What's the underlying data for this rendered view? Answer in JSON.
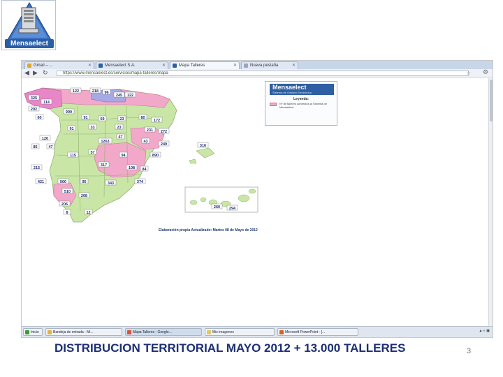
{
  "logo": {
    "text": "Mensaelect"
  },
  "browser": {
    "tabs": [
      {
        "label": "Gmail – ..."
      },
      {
        "label": "Mensaelect S.A."
      },
      {
        "label": "Mapa Talleres"
      },
      {
        "label": "Nueva pestaña"
      }
    ],
    "address": "https://www.mensaelect.es/servicios/mapa-talleres/mapa",
    "nav": {
      "back": "◀",
      "forward": "▶",
      "reload": "↻"
    }
  },
  "legend": {
    "brand": "Mensaelect",
    "brand_sub": "Sistema de Gestión Electrónica",
    "title": "Leyenda:",
    "item_text": "Nº de talleres adheridos al Sistema de Mensaelect"
  },
  "credit": "Elaboración propia Actualizado: Martes 08 de Mayo de 2012",
  "map": {
    "fill_color_mainland": "#c9e6a6",
    "fill_color_highlight": "#f2a8c8",
    "fill_color_north": "#f7b6d0",
    "values": [
      {
        "label": "325",
        "color": "#e887c7"
      },
      {
        "label": "114",
        "color": "#e887c7"
      },
      {
        "label": "292",
        "color": "#e887c7"
      },
      {
        "label": "122",
        "color": "#a7a9e6"
      },
      {
        "label": "218",
        "color": "#a7a9e6"
      },
      {
        "label": "96",
        "color": "#a7a9e6"
      },
      {
        "label": "245",
        "color": "#f2a8c8"
      },
      {
        "label": "122",
        "color": "#f2a8c8"
      },
      {
        "label": "900",
        "color": "#c9e6a6"
      },
      {
        "label": "60",
        "color": "#c9e6a6"
      },
      {
        "label": "91",
        "color": "#c9e6a6"
      },
      {
        "label": "59",
        "color": "#c9e6a6"
      },
      {
        "label": "23",
        "color": "#c9e6a6"
      },
      {
        "label": "80",
        "color": "#c9e6a6"
      },
      {
        "label": "172",
        "color": "#c9e6a6"
      },
      {
        "label": "91",
        "color": "#c9e6a6"
      },
      {
        "label": "33",
        "color": "#c9e6a6"
      },
      {
        "label": "23",
        "color": "#c9e6a6"
      },
      {
        "label": "231",
        "color": "#c9e6a6"
      },
      {
        "label": "272",
        "color": "#c9e6a6"
      },
      {
        "label": "120",
        "color": "#c9e6a6"
      },
      {
        "label": "85",
        "color": "#c9e6a6"
      },
      {
        "label": "47",
        "color": "#f2a8c8"
      },
      {
        "label": "1263",
        "color": "#c9e6a6"
      },
      {
        "label": "67",
        "color": "#f2a8c8"
      },
      {
        "label": "43",
        "color": "#f2a8c8"
      },
      {
        "label": "249",
        "color": "#c9e6a6"
      },
      {
        "label": "115",
        "color": "#c9e6a6"
      },
      {
        "label": "57",
        "color": "#f2a8c8"
      },
      {
        "label": "94",
        "color": "#f2a8c8"
      },
      {
        "label": "890",
        "color": "#c9e6a6"
      },
      {
        "label": "215",
        "color": "#c9e6a6"
      },
      {
        "label": "317",
        "color": "#f2a8c8"
      },
      {
        "label": "108",
        "color": "#c9e6a6"
      },
      {
        "label": "84",
        "color": "#c9e6a6"
      },
      {
        "label": "421",
        "color": "#f2a8c8"
      },
      {
        "label": "500",
        "color": "#c9e6a6"
      },
      {
        "label": "95",
        "color": "#c9e6a6"
      },
      {
        "label": "343",
        "color": "#c9e6a6"
      },
      {
        "label": "374",
        "color": "#c9e6a6"
      },
      {
        "label": "510",
        "color": "#c9e6a6"
      },
      {
        "label": "208",
        "color": "#c9e6a6"
      },
      {
        "label": "206",
        "color": "#f2a8c8"
      },
      {
        "label": "8",
        "color": "#f2a8c8"
      },
      {
        "label": "12",
        "color": "#f2a8c8"
      },
      {
        "label": "316",
        "color": "#c9e6a6"
      },
      {
        "label": "260",
        "color": "#c9e6a6"
      },
      {
        "label": "294",
        "color": "#c9e6a6"
      }
    ]
  },
  "taskbar": {
    "items": [
      {
        "label": "Inicio"
      },
      {
        "label": "Bandeja de entrada - Mi..."
      },
      {
        "label": "Mapa Talleres - Google..."
      },
      {
        "label": "Mis imagenes"
      },
      {
        "label": "Microsoft PowerPoint - [..."
      }
    ]
  },
  "caption": "DISTRIBUCION TERRITORIAL MAYO 2012 + 13.000 TALLERES",
  "page_number": "3"
}
